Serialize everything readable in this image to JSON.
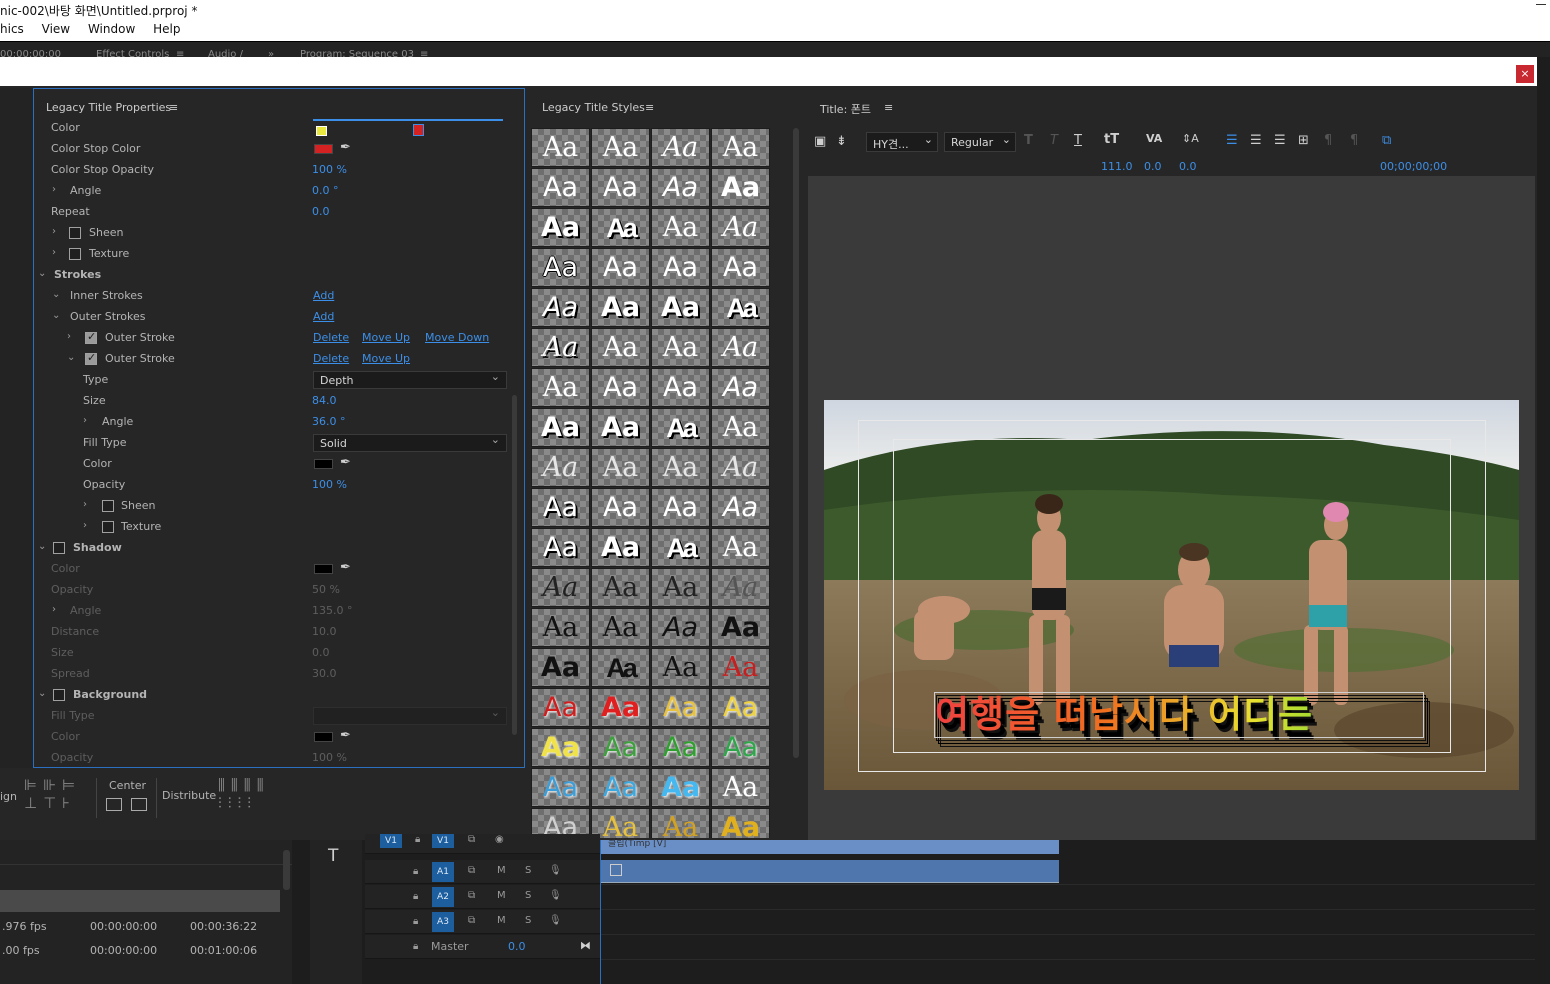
{
  "titlebar": {
    "text": "nic-002\\바탕 화면\\Untitled.prproj *"
  },
  "menu": [
    "hics",
    "View",
    "Window",
    "Help"
  ],
  "panel_strip": {
    "timecode": "00:00:00:00",
    "tab_effect_controls": "Effect Controls",
    "tab_audio": "Audio /",
    "tab_program": "Program: Sequence 03",
    "overflow": "»"
  },
  "dialog": {
    "close": "×"
  },
  "props": {
    "title": "Legacy Title Properties",
    "menu_icon": "≡",
    "rows": [
      {
        "label": "Color",
        "type": "gradient"
      },
      {
        "label": "Color Stop Color",
        "swatch": "#d42222"
      },
      {
        "label": "Color Stop Opacity",
        "value": "100 %"
      },
      {
        "label": "Angle",
        "value": "0.0 °",
        "chev": true
      },
      {
        "label": "Repeat",
        "value": "0.0"
      },
      {
        "label": "Sheen",
        "chev": true,
        "check": false
      },
      {
        "label": "Texture",
        "chev": true,
        "check": false
      },
      {
        "label": "Strokes",
        "section": true
      },
      {
        "label": "Inner Strokes",
        "link1": "Add"
      },
      {
        "label": "Outer Strokes",
        "link1": "Add"
      },
      {
        "label": "Outer Stroke",
        "check": true,
        "link1": "Delete",
        "link2": "Move Up",
        "link3": "Move Down"
      },
      {
        "label": "Outer Stroke",
        "check": true,
        "link1": "Delete",
        "link2": "Move Up"
      },
      {
        "label": "Type",
        "select": "Depth"
      },
      {
        "label": "Size",
        "value": "84.0"
      },
      {
        "label": "Angle",
        "value": "36.0 °",
        "chev": true
      },
      {
        "label": "Fill Type",
        "select": "Solid"
      },
      {
        "label": "Color",
        "swatch": "#000000"
      },
      {
        "label": "Opacity",
        "value": "100 %"
      },
      {
        "label": "Sheen",
        "check": false,
        "chev": true
      },
      {
        "label": "Texture",
        "check": false,
        "chev": true
      },
      {
        "label": "Shadow",
        "section": true,
        "check": false
      },
      {
        "label": "Color",
        "swatch": "#000000",
        "dim": true
      },
      {
        "label": "Opacity",
        "value": "50 %",
        "dim": true
      },
      {
        "label": "Angle",
        "value": "135.0 °",
        "dim": true,
        "chev": true
      },
      {
        "label": "Distance",
        "value": "10.0",
        "dim": true
      },
      {
        "label": "Size",
        "value": "0.0",
        "dim": true
      },
      {
        "label": "Spread",
        "value": "30.0",
        "dim": true
      },
      {
        "label": "Background",
        "section": true,
        "check": false
      },
      {
        "label": "Fill Type",
        "dim": true,
        "emptyselect": true
      },
      {
        "label": "Color",
        "swatch": "#000000",
        "dim": true
      },
      {
        "label": "Opacity",
        "value": "100 %",
        "dim": true
      }
    ]
  },
  "align": {
    "label_align": "ign",
    "label_center": "Center",
    "label_distribute": "Distribute"
  },
  "styles": {
    "title": "Legacy Title Styles",
    "menu_icon": "≡",
    "sample": "Aa",
    "cells": [
      [
        "#ffffff",
        "serif",
        ""
      ],
      [
        "#ffffff",
        "serif",
        ""
      ],
      [
        "#ffffff",
        "serif",
        ""
      ],
      [
        "#ffffff",
        "serif",
        "thin"
      ],
      [
        "#ffffff",
        "sans",
        ""
      ],
      [
        "#ffffff",
        "sans",
        ""
      ],
      [
        "#ffffff",
        "sansital",
        ""
      ],
      [
        "#ffffff",
        "sansbold",
        ""
      ],
      [
        "#ffffff",
        "sansbold",
        "shadow"
      ],
      [
        "#ffffff",
        "condensed",
        "shadow"
      ],
      [
        "#ffffff",
        "serif",
        ""
      ],
      [
        "#ffffff",
        "serif",
        ""
      ],
      [
        "#ffffff",
        "sans",
        "outline"
      ],
      [
        "#ffffff",
        "sans",
        ""
      ],
      [
        "#ffffff",
        "sans",
        "thin"
      ],
      [
        "#ffffff",
        "sans",
        ""
      ],
      [
        "#ffffff",
        "sansital",
        "shadow"
      ],
      [
        "#ffffff",
        "sansbold",
        "shadow"
      ],
      [
        "#ffffff",
        "sansbold",
        "shadow"
      ],
      [
        "#ffffff",
        "condensed",
        "shadow"
      ],
      [
        "#ffffff",
        "serif",
        "shadow"
      ],
      [
        "#ffffff",
        "serif",
        ""
      ],
      [
        "#ffffff",
        "serif",
        ""
      ],
      [
        "#ffffff",
        "serif",
        ""
      ],
      [
        "#ffffff",
        "serif",
        "thin"
      ],
      [
        "#ffffff",
        "sans",
        ""
      ],
      [
        "#ffffff",
        "sans",
        ""
      ],
      [
        "#ffffff",
        "sansital",
        ""
      ],
      [
        "#ffffff",
        "sansbold",
        "shadow"
      ],
      [
        "#ffffff",
        "sansbold",
        "shadow"
      ],
      [
        "#ffffff",
        "condensed",
        "shadow"
      ],
      [
        "#ffffff",
        "serif",
        ""
      ],
      [
        "#e6e6e6",
        "serif",
        "thin"
      ],
      [
        "#e6e6e6",
        "serif",
        "thin"
      ],
      [
        "#e6e6e6",
        "serif",
        "thin"
      ],
      [
        "#e6e6e6",
        "serif",
        "thin"
      ],
      [
        "#ffffff",
        "sans",
        "shadow"
      ],
      [
        "#ffffff",
        "sans",
        ""
      ],
      [
        "#ffffff",
        "sans",
        ""
      ],
      [
        "#ffffff",
        "sansital",
        ""
      ],
      [
        "#ffffff",
        "sans",
        "shadow"
      ],
      [
        "#ffffff",
        "sansbold",
        "shadow"
      ],
      [
        "#ffffff",
        "condensed",
        "shadow"
      ],
      [
        "#ffffff",
        "serif",
        ""
      ],
      [
        "#222222",
        "serif",
        "thin"
      ],
      [
        "#222222",
        "serif",
        "thin"
      ],
      [
        "#222222",
        "serif",
        ""
      ],
      [
        "#555555",
        "serif",
        "thin"
      ],
      [
        "#111111",
        "serif",
        ""
      ],
      [
        "#111111",
        "serif",
        ""
      ],
      [
        "#111111",
        "sansital",
        ""
      ],
      [
        "#111111",
        "sansbold",
        ""
      ],
      [
        "#111111",
        "sansbold",
        ""
      ],
      [
        "#111111",
        "condensed",
        ""
      ],
      [
        "#111111",
        "serif",
        ""
      ],
      [
        "#c81e1e",
        "serif",
        ""
      ],
      [
        "#d01e1e",
        "sans",
        "glow"
      ],
      [
        "#e02020",
        "sansbold",
        "glow"
      ],
      [
        "#e8c23c",
        "sans",
        "glow"
      ],
      [
        "#f0d23c",
        "sans",
        "glow"
      ],
      [
        "#f0e24a",
        "sansbold",
        "glow"
      ],
      [
        "#3ca03c",
        "sans",
        "glow"
      ],
      [
        "#2ea02e",
        "sans",
        "glow"
      ],
      [
        "#2ea64a",
        "sans",
        "glow"
      ],
      [
        "#3c9ed8",
        "sans",
        "glow"
      ],
      [
        "#3ca8e0",
        "sans",
        "glow"
      ],
      [
        "#46b8f0",
        "sansbold",
        "glow"
      ],
      [
        "#ffffff",
        "serif",
        ""
      ],
      [
        "#d0d0d0",
        "sans",
        ""
      ],
      [
        "#e8c23c",
        "serif",
        ""
      ],
      [
        "#d4a21e",
        "serif",
        ""
      ],
      [
        "#e0b01e",
        "sansbold",
        ""
      ]
    ]
  },
  "title_panel": {
    "title": "Title: 폰트",
    "menu_icon": "≡",
    "font_family": "HY견...",
    "font_style": "Regular",
    "font_size": "111.0",
    "kerning": "0.0",
    "leading": "0.0",
    "timecode": "00;00;00;00",
    "overlay_text": "여행을 떠납시다  어디든",
    "overlay_colors": [
      "#f04040",
      "#f07020",
      "#e8e030",
      "#30d030"
    ]
  },
  "timeline": {
    "tracks": [
      {
        "name": "V1",
        "src": "V1"
      },
      {
        "name": "A1",
        "m": "M",
        "s": "S"
      },
      {
        "name": "A2",
        "m": "M",
        "s": "S"
      },
      {
        "name": "A3",
        "m": "M",
        "s": "S"
      }
    ],
    "master": {
      "label": "Master",
      "value": "0.0"
    },
    "clip_label": "클립(Timp [V]"
  },
  "project": {
    "rows": [
      {
        "fps": ".976 fps",
        "start": "00:00:00:00",
        "dur": "00:00:36:22"
      },
      {
        "fps": ".00 fps",
        "start": "00:00:00:00",
        "dur": "00:01:00:06"
      }
    ]
  },
  "tool": {
    "type_tool": "T"
  }
}
